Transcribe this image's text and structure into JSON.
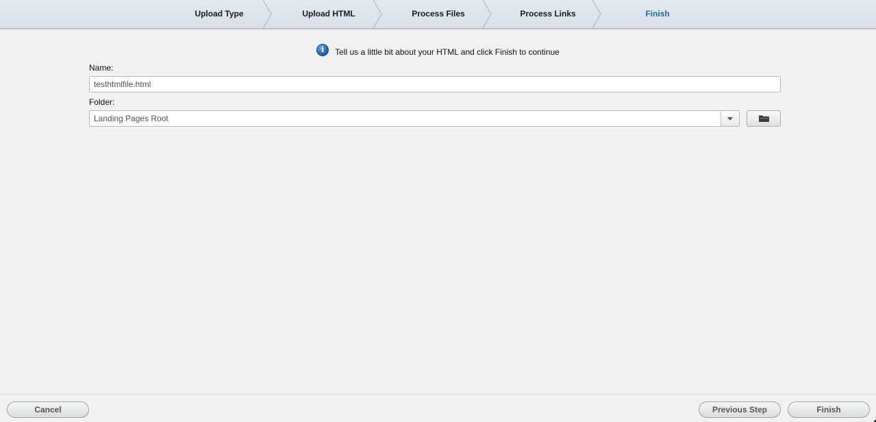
{
  "wizard": {
    "steps": [
      {
        "label": "Upload Type"
      },
      {
        "label": "Upload HTML"
      },
      {
        "label": "Process Files"
      },
      {
        "label": "Process Links"
      },
      {
        "label": "Finish",
        "current": true
      }
    ],
    "current_color": "#2a64a6"
  },
  "info": {
    "icon": "info-icon",
    "message": "Tell us a little bit about your HTML and click Finish to continue"
  },
  "form": {
    "name_label": "Name:",
    "name_value": "testhtmlfile.html",
    "folder_label": "Folder:",
    "folder_value": "Landing Pages Root",
    "folder_trigger_icon": "chevron-down-icon",
    "folder_browse_icon": "folder-icon"
  },
  "footer": {
    "cancel_label": "Cancel",
    "previous_label": "Previous Step",
    "finish_label": "Finish"
  }
}
